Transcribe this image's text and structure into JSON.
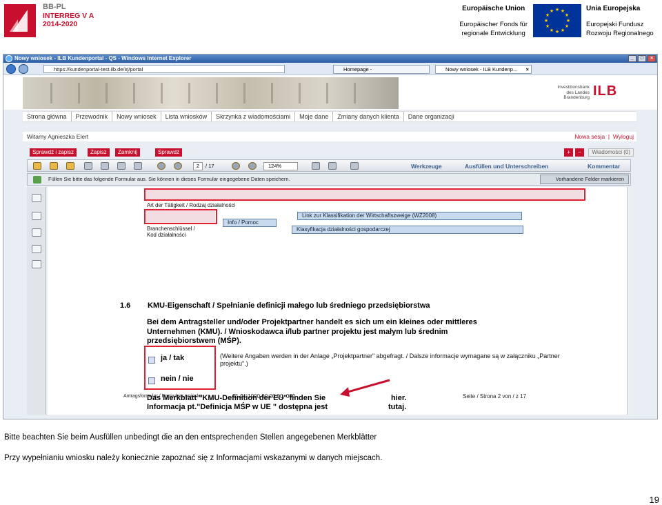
{
  "header": {
    "logo_line1": "BB-PL",
    "logo_line2": "INTERREG V A",
    "logo_line3": "2014-2020",
    "eu_left_title": "Europäische Union",
    "eu_left_line1": "Europäischer Fonds für",
    "eu_left_line2": "regionale Entwicklung",
    "eu_right_title": "Unia Europejska",
    "eu_right_line1": "Europejski Fundusz",
    "eu_right_line2": "Rozwoju Regionalnego",
    "colors": {
      "brand_red": "#c8102e",
      "eu_blue": "#003399",
      "eu_star": "#ffcc00"
    }
  },
  "browser": {
    "title": "Nowy wniosek - ILB Kundenportal - QS - Windows Internet Explorer",
    "url": "https://kundenportal-test.ilb.de/irj/portal",
    "tabs": [
      {
        "label": "Homepage -"
      },
      {
        "label": "Nowy wniosek - ILB Kundenp..."
      }
    ]
  },
  "site": {
    "ilb_text_line1": "Investitionsbank",
    "ilb_text_line2": "des Landes",
    "ilb_text_line3": "Brandenburg",
    "ilb_logo": "ILB",
    "nav": [
      "Strona główna",
      "Przewodnik",
      "Nowy wniosek",
      "Lista wniosków",
      "Skrzynka z wiadomościami",
      "Moje dane",
      "Zmiany danych klienta",
      "Dane organizacji"
    ],
    "welcome": "Witamy Agnieszka Elert",
    "new_session": "Nowa sesja",
    "logout": "Wyloguj",
    "actions": [
      "Sprawdź i zapisz",
      "Zapisz",
      "Zamknij",
      "Sprawdź"
    ],
    "messages": "Wiadomości (0)"
  },
  "pdf": {
    "page_num": "2",
    "page_total": "/ 17",
    "zoom": "124%",
    "tools": "Werkzeuge",
    "fill_sign": "Ausfüllen und Unterschreiben",
    "comment": "Kommentar",
    "hint": "Füllen Sie bitte das folgende Formular aus. Sie können in dieses Formular eingegebene Daten speichern.",
    "mark_fields": "Vorhandene Felder markieren",
    "activity_label": "Art der Tätigkeit / Rodzaj działalności",
    "link_de": "Link zur Klassifikation der Wirtschaftszweige (WZ2008)",
    "link_pl": "Klasyfikacja działalności gospodarczej",
    "info_btn": "Info / Pomoc",
    "branch_label_1": "Branchenschlüssel /",
    "branch_label_2": "Kod działalności",
    "section_num": "1.6",
    "section_title": "KMU-Eigenschaft / Spełnianie definicji małego lub średniego przedsiębiorstwa",
    "section_body": "Bei dem Antragsteller und/oder Projektpartner handelt es sich um ein kleines oder mittleres Unternehmen (KMU). / Wnioskodawca i/lub partner projektu jest małym lub średnim przedsiębiorstwem (MŚP).",
    "option_yes": "ja / tak",
    "option_no": "nein / nie",
    "further_info": "(Weitere Angaben werden in der Anlage „Projektpartner\" abgefragt. / Dalsze informacje wymagane są w załączniku „Partner projektu\".)",
    "merkblatt_de": "Das Merkblatt \"KMU-Definition der EU\" finden Sie",
    "merkblatt_pl": "Informacja pt.\"Definicja MŚP w UE \" dostępna jest",
    "here_de": "hier.",
    "here_pl": "tutaj.",
    "footer_form": "Antragsformular / Formularz wniosku",
    "footer_date": "01.01.1900 00:00:00, 000",
    "footer_page": "Seite / Strona   2   von / z  17"
  },
  "captions": {
    "de": "Bitte beachten Sie beim Ausfüllen unbedingt die an den entsprechenden Stellen angegebenen Merkblätter",
    "pl": "Przy wypełnianiu wniosku należy koniecznie zapoznać się z Informacjami  wskazanymi w danych miejscach."
  },
  "page_number": "19"
}
